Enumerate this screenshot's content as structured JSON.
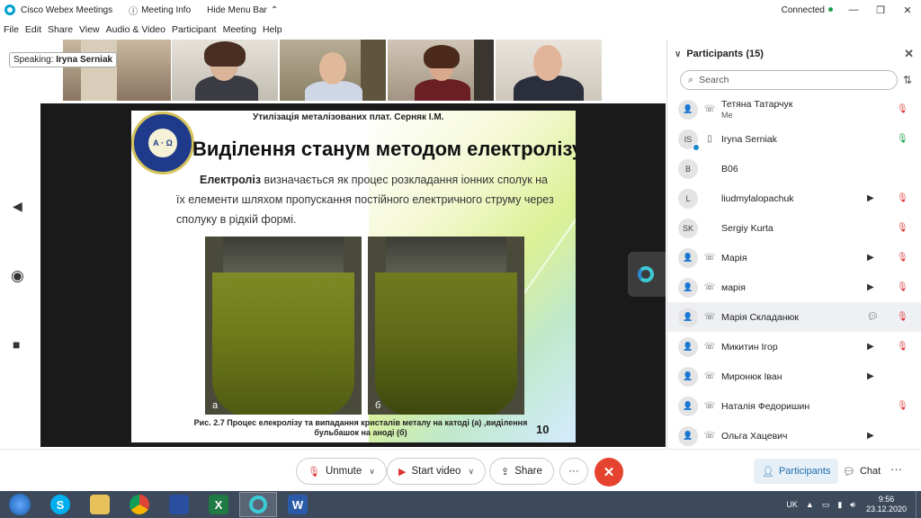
{
  "titlebar": {
    "app_name": "Cisco Webex Meetings",
    "meeting_info": "Meeting Info",
    "hide_menu": "Hide Menu Bar",
    "status": "Connected",
    "status_color": "#1aa14a"
  },
  "menu": [
    "File",
    "Edit",
    "Share",
    "View",
    "Audio & Video",
    "Participant",
    "Meeting",
    "Help"
  ],
  "speaking": {
    "label": "Speaking:",
    "name": "Iryna Serniak"
  },
  "slide": {
    "header": "Утилізація металізованих плат. Серняк І.М.",
    "logo_text": "Α · Ω",
    "title": "Виділення станум методом електролізу",
    "lead": "Електроліз",
    "text": " визначається як процес розкладання іонних сполук на їх елементи шляхом пропускання постійного електричного струму через сполуку в рідкій формі.",
    "photo_a": "а",
    "photo_b": "б",
    "caption": "Рис. 2.7 Процес елекролізу та випадання  кристалів металу на катоді (а) ,виділення бульбашок на аноді (б)",
    "page": "10"
  },
  "participants": {
    "title": "Participants (15)",
    "search_placeholder": "Search",
    "list": [
      {
        "initials": "",
        "name": "Тетяна Татарчук",
        "sub": "Me",
        "camera": false,
        "mic": "muted"
      },
      {
        "initials": "IS",
        "name": "Iryna Serniak",
        "sub": "",
        "camera": false,
        "mic": "on"
      },
      {
        "initials": "B",
        "name": "B06",
        "sub": "",
        "camera": false,
        "mic": "none"
      },
      {
        "initials": "L",
        "name": "liudmylalopachuk",
        "sub": "",
        "camera": true,
        "mic": "muted"
      },
      {
        "initials": "SK",
        "name": "Sergiy Kurta",
        "sub": "",
        "camera": false,
        "mic": "muted"
      },
      {
        "initials": "",
        "name": "Марія",
        "sub": "",
        "camera": true,
        "mic": "muted"
      },
      {
        "initials": "",
        "name": "марія",
        "sub": "",
        "camera": true,
        "mic": "muted"
      },
      {
        "initials": "",
        "name": "Марія Складанюк",
        "sub": "",
        "camera": false,
        "mic": "muted",
        "chat": true
      },
      {
        "initials": "",
        "name": "Микитин Ігор",
        "sub": "",
        "camera": true,
        "mic": "muted"
      },
      {
        "initials": "",
        "name": "Миронюк Іван",
        "sub": "",
        "camera": true,
        "mic": "none"
      },
      {
        "initials": "",
        "name": "Наталія Федоришин",
        "sub": "",
        "camera": false,
        "mic": "muted"
      },
      {
        "initials": "",
        "name": "Ольга Хацевич",
        "sub": "",
        "camera": true,
        "mic": "none"
      }
    ]
  },
  "controls": {
    "unmute": "Unmute",
    "start_video": "Start video",
    "share": "Share",
    "more": "···",
    "participants": "Participants",
    "chat": "Chat"
  },
  "taskbar": {
    "lang": "UK",
    "time": "9:56",
    "date": "23.12.2020"
  }
}
